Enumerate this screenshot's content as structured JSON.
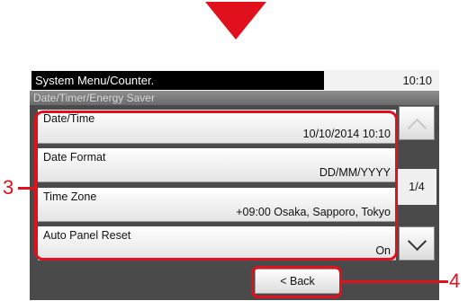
{
  "header": {
    "title": "System Menu/Counter.",
    "time": "10:10"
  },
  "breadcrumb": "Date/Timer/Energy Saver",
  "items": [
    {
      "label": "Date/Time",
      "value": "10/10/2014 10:10"
    },
    {
      "label": "Date Format",
      "value": "DD/MM/YYYY"
    },
    {
      "label": "Time Zone",
      "value": "+09:00 Osaka, Sapporo, Tokyo"
    },
    {
      "label": "Auto Panel Reset",
      "value": "On"
    }
  ],
  "pager": {
    "indicator": "1/4",
    "up_icon": "chevron-up-icon",
    "down_icon": "chevron-down-icon"
  },
  "back_label": "< Back",
  "callouts": {
    "list": "3",
    "back": "4"
  },
  "colors": {
    "highlight": "#e0101c",
    "panel": "#4a4a4a"
  }
}
